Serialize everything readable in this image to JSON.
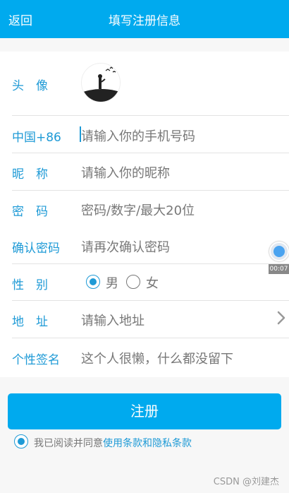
{
  "header": {
    "back_label": "返回",
    "title": "填写注册信息"
  },
  "form": {
    "avatar_label": "头　像",
    "phone_label": "中国+86",
    "phone_placeholder": "请输入你的手机号码",
    "nickname_label": "昵　称",
    "nickname_placeholder": "请输入你的昵称",
    "password_label": "密　码",
    "password_placeholder": "密码/数字/最大20位",
    "confirm_label": "确认密码",
    "confirm_placeholder": "请再次确认密码",
    "gender_label": "性　别",
    "gender_options": [
      "男",
      "女"
    ],
    "gender_selected": "男",
    "address_label": "地　址",
    "address_placeholder": "请输入地址",
    "signature_label": "个性签名",
    "signature_placeholder": "这个人很懒，什么都没留下"
  },
  "floating_timer": {
    "time": "00:07"
  },
  "submit_label": "注册",
  "agreement": {
    "prefix": "我已阅读并同意",
    "link": "使用条款和隐私条款",
    "checked": true
  },
  "watermark": "CSDN @刘建杰",
  "colors": {
    "accent": "#00aaee",
    "label": "#1e9ad6"
  }
}
